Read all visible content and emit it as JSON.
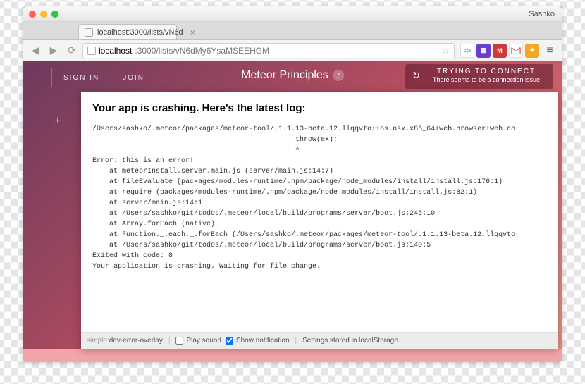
{
  "window": {
    "profile": "Sashko"
  },
  "tab": {
    "title": "localhost:3000/lists/vN6d",
    "close": "×"
  },
  "toolbar": {
    "back": "◀",
    "forward": "▶",
    "reload": "⟳",
    "menu": "≡",
    "star": "☆"
  },
  "url": {
    "host": "localhost",
    "rest": ":3000/lists/vN6dMy6YsaMSEEHGM"
  },
  "extensions": {
    "cjs": "cjs",
    "wave": "▦",
    "m": "M",
    "orange": "✦"
  },
  "app": {
    "signin": "SIGN IN",
    "join": "JOIN",
    "title": "Meteor Principles",
    "badge": "7",
    "plus": "+"
  },
  "banner": {
    "refresh": "↻",
    "line1": "TRYING TO CONNECT",
    "line2": "There seems to be a connection issue"
  },
  "error": {
    "heading": "Your app is crashing. Here's the latest log:",
    "log": "/Users/sashko/.meteor/packages/meteor-tool/.1.1.13-beta.12.llqqvto++os.osx.x86_64+web.browser+web.co\n                                                throw(ex);\n                                                ^\nError: this is an error!\n    at meteorInstall.server.main.js (server/main.js:14:7)\n    at fileEvaluate (packages/modules-runtime/.npm/package/node_modules/install/install.js:176:1)\n    at require (packages/modules-runtime/.npm/package/node_modules/install/install.js:82:1)\n    at server/main.js:14:1\n    at /Users/sashko/git/todos/.meteor/local/build/programs/server/boot.js:245:10\n    at Array.forEach (native)\n    at Function._.each._.forEach (/Users/sashko/.meteor/packages/meteor-tool/.1.1.13-beta.12.llqqvto\n    at /Users/sashko/git/todos/.meteor/local/build/programs/server/boot.js:140:5\nExited with code: 8\nYour application is crashing. Waiting for file change."
  },
  "footer": {
    "pkg_scope": "simple:",
    "pkg_name": "dev-error-overlay",
    "playsound": "Play sound",
    "shownotif": "Show notification",
    "storage": "Settings stored in localStorage."
  }
}
